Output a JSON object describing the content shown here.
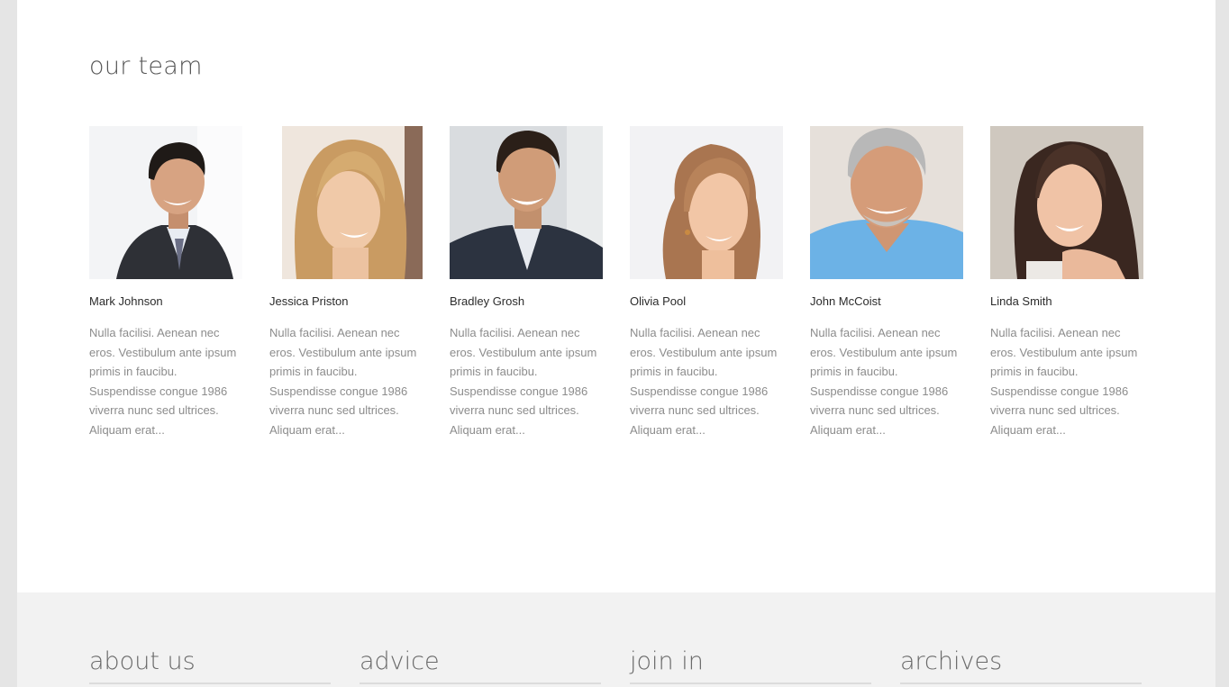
{
  "team": {
    "title": "our team",
    "members": [
      {
        "name": "Mark Johnson",
        "bio": "Nulla facilisi. Aenean nec eros. Vestibulum ante ipsum primis in faucibu. Suspendisse congue 1986 viverra nunc sed ultrices. Aliquam erat...",
        "photo_icon": "portrait-man-suit"
      },
      {
        "name": "Jessica Priston",
        "bio": "Nulla facilisi. Aenean nec eros. Vestibulum ante ipsum primis in faucibu. Suspendisse congue 1986 viverra nunc sed ultrices. Aliquam erat...",
        "photo_icon": "portrait-woman-blonde"
      },
      {
        "name": "Bradley Grosh",
        "bio": "Nulla facilisi. Aenean nec eros. Vestibulum ante ipsum primis in faucibu. Suspendisse congue 1986 viverra nunc sed ultrices. Aliquam erat...",
        "photo_icon": "portrait-man-dark-hair"
      },
      {
        "name": "Olivia Pool",
        "bio": "Nulla facilisi. Aenean nec eros. Vestibulum ante ipsum primis in faucibu. Suspendisse congue 1986 viverra nunc sed ultrices. Aliquam erat...",
        "photo_icon": "portrait-woman-ponytail"
      },
      {
        "name": "John McCoist",
        "bio": "Nulla facilisi. Aenean nec eros. Vestibulum ante ipsum primis in faucibu. Suspendisse congue 1986 viverra nunc sed ultrices. Aliquam erat...",
        "photo_icon": "portrait-older-man"
      },
      {
        "name": "Linda Smith",
        "bio": "Nulla facilisi. Aenean nec eros. Vestibulum ante ipsum primis in faucibu. Suspendisse congue 1986 viverra nunc sed ultrices. Aliquam erat...",
        "photo_icon": "portrait-woman-brunette"
      }
    ]
  },
  "footer": {
    "columns": [
      {
        "title": "about us"
      },
      {
        "title": "advice"
      },
      {
        "title": "join in"
      },
      {
        "title": "archives"
      }
    ]
  },
  "colors": {
    "page_background": "#e5e5e5",
    "content_background": "#ffffff",
    "footer_background": "#f2f2f2",
    "heading_text": "#555555",
    "name_text": "#2b2b2b",
    "bio_text": "#8c8c8c"
  }
}
